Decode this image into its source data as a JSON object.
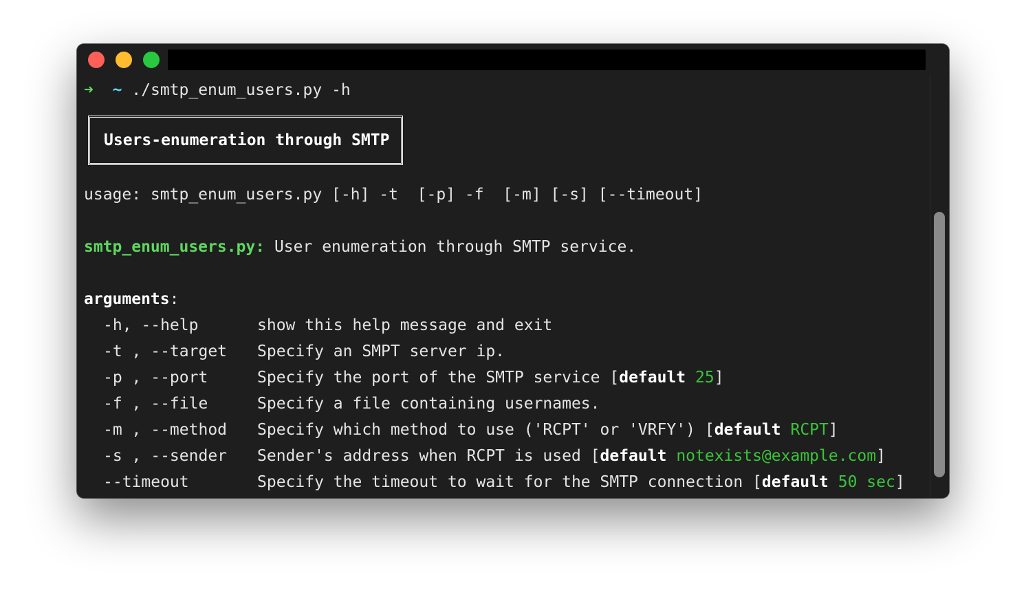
{
  "window": {
    "controls": {
      "close_color": "#fe5f57",
      "minimize_color": "#febc2e",
      "maximize_color": "#28c840"
    }
  },
  "terminal": {
    "prompt": {
      "arrow": "➜",
      "dir": "~",
      "command": "./smtp_enum_users.py -h"
    },
    "banner": "Users-enumeration through SMTP",
    "usage": "usage: smtp_enum_users.py [-h] -t  [-p] -f  [-m] [-s] [--timeout]",
    "description": {
      "prog": "smtp_enum_users.py:",
      "text": " User enumeration through SMTP service."
    },
    "arguments_header": "arguments",
    "arguments_colon": ":",
    "default_word": "default",
    "arguments": [
      {
        "flags": "-h, --help",
        "desc": "show this help message and exit",
        "default": ""
      },
      {
        "flags": "-t , --target",
        "desc": "Specify an SMPT server ip.",
        "default": ""
      },
      {
        "flags": "-p , --port",
        "desc": "Specify the port of the SMTP service ",
        "default": "25"
      },
      {
        "flags": "-f , --file",
        "desc": "Specify a file containing usernames.",
        "default": ""
      },
      {
        "flags": "-m , --method",
        "desc": "Specify which method to use ('RCPT' or 'VRFY') ",
        "default": "RCPT"
      },
      {
        "flags": "-s , --sender",
        "desc": "Sender's address when RCPT is used ",
        "default": "notexists@example.com"
      },
      {
        "flags": "--timeout",
        "desc": "Specify the timeout to wait for the SMTP connection ",
        "default": "50 sec"
      }
    ]
  }
}
